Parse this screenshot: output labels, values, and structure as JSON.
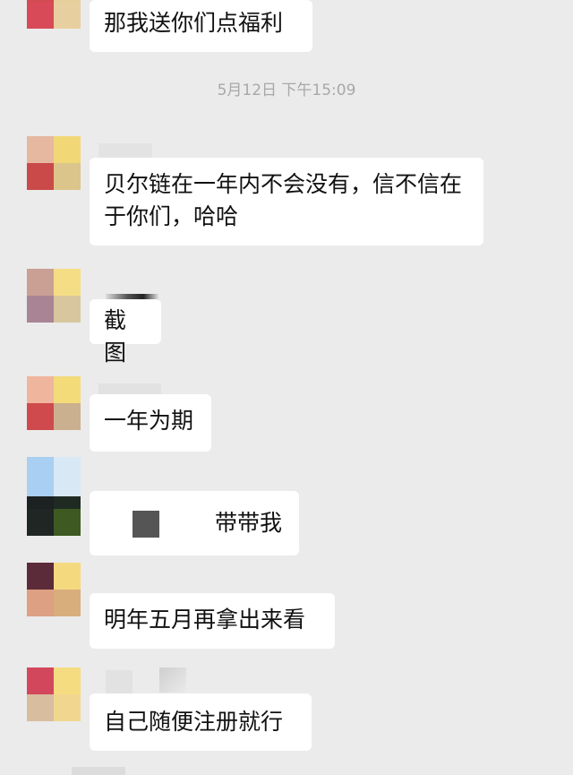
{
  "timestamp": "5月12日 下午15:09",
  "messages": [
    {
      "text": "那我送你们点福利",
      "avatar": [
        "#d24a52",
        "#e6cf9a",
        "#d84a57",
        "#e8cfa0"
      ]
    },
    {
      "text": "贝尔链在一年内不会没有，信不信在于你们，哈哈",
      "avatar": [
        "#e6b8a0",
        "#f2d777",
        "#c94a48",
        "#dcc58a"
      ]
    },
    {
      "text": "截图",
      "avatar": [
        "#c9a093",
        "#f5dd86",
        "#a98494",
        "#d8c79e"
      ]
    },
    {
      "text": "一年为期",
      "avatar": [
        "#f0b69d",
        "#f3db7a",
        "#cf4a4c",
        "#cbb08f"
      ]
    },
    {
      "text": "带带我",
      "avatar": [
        "#a9cff2",
        "#d8e8f4",
        "#1b2221",
        "#1e2a22"
      ]
    },
    {
      "text": "明年五月再拿出来看",
      "avatar": [
        "#5c2b39",
        "#f5d97e",
        "#dda083",
        "#d8ae7d"
      ]
    },
    {
      "text": "自己随便注册就行",
      "avatar": [
        "#d3475d",
        "#f5dc80",
        "#d8bd9f",
        "#f1d690"
      ]
    }
  ],
  "colors": {
    "background": "#ebebeb",
    "bubble": "#ffffff",
    "text": "#111111",
    "timestamp": "#a8a8a8"
  }
}
